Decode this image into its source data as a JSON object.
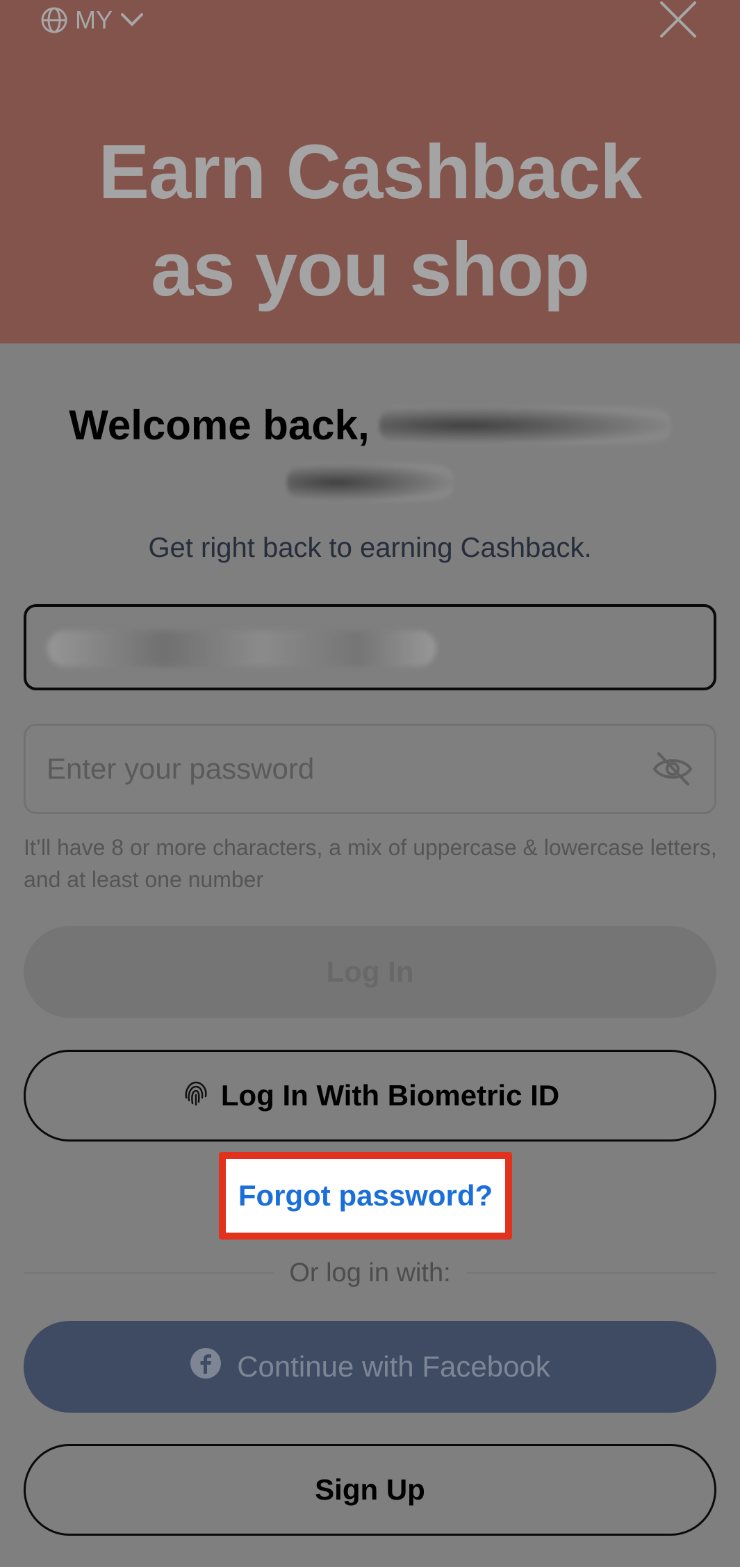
{
  "header": {
    "region_label": "MY",
    "hero_title_line1": "Earn Cashback",
    "hero_title_line2": "as you shop"
  },
  "login": {
    "welcome_text": "Welcome back,",
    "subtitle": "Get right back to earning Cashback.",
    "password_placeholder": "Enter your password",
    "password_hint": "It’ll have 8 or more characters, a mix of uppercase & lowercase letters, and at least one number",
    "login_button": "Log In",
    "biometric_button": "Log In With Biometric ID",
    "forgot_password": "Forgot password?",
    "divider_text": "Or log in with:",
    "facebook_button": "Continue with Facebook",
    "signup_button": "Sign Up"
  },
  "colors": {
    "hero_bg": "#83544c",
    "overlay_bg": "#7f7f7f",
    "link_blue": "#1a6fd9",
    "highlight_red": "#e2311d",
    "facebook_bg": "#3e4b63"
  },
  "icons": [
    "globe-icon",
    "chevron-down-icon",
    "close-icon",
    "eye-off-icon",
    "fingerprint-icon",
    "facebook-icon"
  ]
}
